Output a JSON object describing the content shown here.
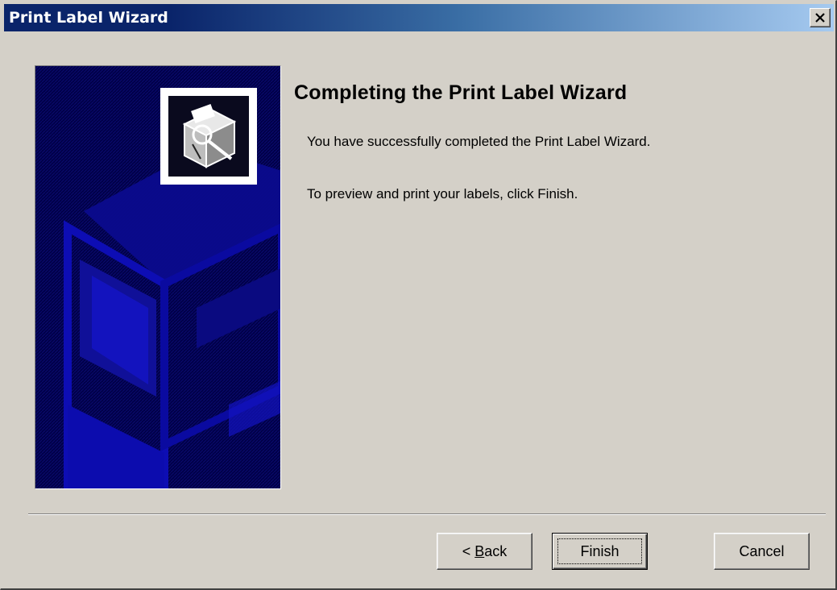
{
  "window": {
    "title": "Print Label Wizard",
    "close_glyph": "✕"
  },
  "sidebar": {
    "icon": "label-printer-wizard-icon",
    "background_color": "#000080"
  },
  "content": {
    "heading": "Completing the Print Label Wizard",
    "line1": "You have successfully completed the Print Label Wizard.",
    "line2": "To preview and print your labels, click Finish."
  },
  "buttons": {
    "back_prefix": "< ",
    "back_mnemonic": "B",
    "back_rest": "ack",
    "finish": "Finish",
    "cancel": "Cancel"
  }
}
